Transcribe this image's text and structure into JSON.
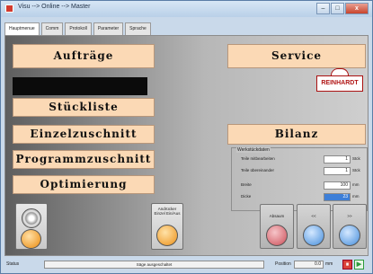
{
  "window": {
    "title": "Visu --> Online --> Master",
    "minimize": "–",
    "maximize": "□",
    "close": "x"
  },
  "tabs": [
    "Hauptmenue",
    "Comm",
    "Protokoll",
    "Parameter",
    "Sprache"
  ],
  "buttons": {
    "auftraege": "Aufträge",
    "service": "Service",
    "stueckliste": "Stückliste",
    "einzelzuschnitt": "Einzelzuschnitt",
    "bilanz": "Bilanz",
    "programmzuschnitt": "Programmzuschnitt",
    "optimierung": "Optimierung"
  },
  "logo": {
    "text": "REINHARDT"
  },
  "panel": {
    "title": "Werkstückdaten",
    "fields": [
      {
        "label": "Teile mitbearbeiten",
        "value": "1",
        "unit": "Stck"
      },
      {
        "label": "Teile übereinander",
        "value": "1",
        "unit": "Stck"
      },
      {
        "label": "Breite",
        "value": "100",
        "unit": "mm"
      },
      {
        "label": "Dicke",
        "value": "23",
        "unit": "mm"
      }
    ]
  },
  "controls": {
    "middle_label": "Andrücker Einzel Ein/Aus",
    "lamp1_label": "Absaum",
    "lamp2_label": "<<",
    "lamp3_label": ">>"
  },
  "status": {
    "label": "Status",
    "message": "Säge ausgeschaltet",
    "position_label": "Position",
    "position_value": "0.0",
    "position_unit": "mm",
    "icon1": "⏸",
    "icon2": "▶"
  },
  "colors": {
    "button_bg": "#fbd9b5",
    "lamp_red": "#d9727a",
    "lamp_blue": "#6fa8e6",
    "lamp_orange": "#f7b45a"
  }
}
